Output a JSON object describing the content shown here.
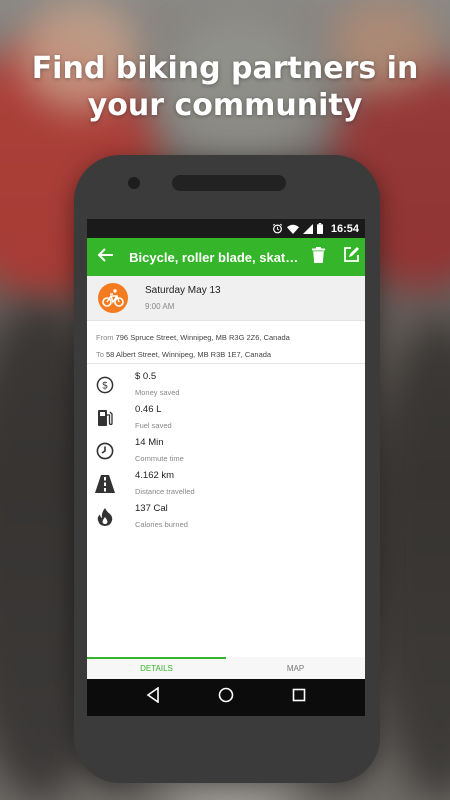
{
  "headline": {
    "line1": "Find biking partners in",
    "line2": "your community"
  },
  "statusbar": {
    "time": "16:54",
    "icons": [
      "alarm-icon",
      "wifi-icon",
      "signal-icon",
      "battery-icon"
    ]
  },
  "appbar": {
    "title": "Bicycle, roller blade, skateboard",
    "back_icon": "arrow-left-icon",
    "actions": [
      "trash-icon",
      "edit-icon"
    ],
    "color": "#35b529"
  },
  "trip": {
    "date": "Saturday May 13",
    "time": "9:00 AM",
    "mode_icon": "bicycle-icon",
    "mode_color": "#f47b20",
    "from_label": "From",
    "from_address": "796 Spruce Street, Winnipeg, MB R3G 2Z6, Canada",
    "to_label": "To",
    "to_address": "58 Albert Street, Winnipeg, MB R3B 1E7, Canada"
  },
  "stats": [
    {
      "icon": "dollar-icon",
      "value": "$ 0.5",
      "label": "Money saved"
    },
    {
      "icon": "fuel-pump-icon",
      "value": "0.46 L",
      "label": "Fuel saved"
    },
    {
      "icon": "clock-icon",
      "value": "14 Min",
      "label": "Commute time"
    },
    {
      "icon": "road-icon",
      "value": "4.162 km",
      "label": "Distance travelled"
    },
    {
      "icon": "flame-icon",
      "value": "137 Cal",
      "label": "Calories burned"
    }
  ],
  "tabs": [
    {
      "label": "DETAILS",
      "active": true
    },
    {
      "label": "MAP",
      "active": false
    }
  ],
  "navbar": [
    "back-triangle-icon",
    "home-circle-icon",
    "recents-square-icon"
  ]
}
